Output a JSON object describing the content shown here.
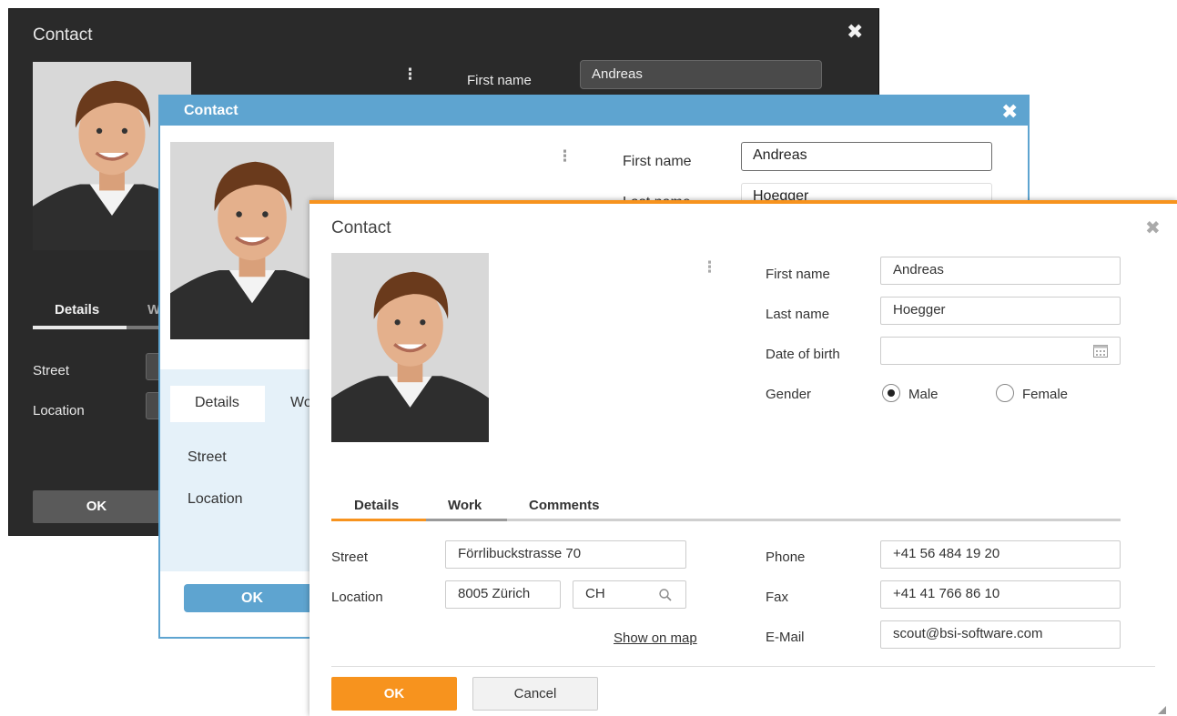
{
  "dark_dialog": {
    "title": "Contact",
    "close_glyph": "✖",
    "kebab_glyph": "⋮",
    "first_name_label": "First name",
    "first_name_value": "Andreas",
    "tabs": [
      "Details",
      "W"
    ],
    "street_label": "Street",
    "location_label": "Location",
    "ok_label": "OK",
    "colors": {
      "background": "#2a2a2a"
    }
  },
  "blue_dialog": {
    "title": "Contact",
    "close_glyph": "✖",
    "kebab_glyph": "⋮",
    "first_name_label": "First name",
    "first_name_value": "Andreas",
    "last_name_label": "Last name",
    "last_name_value": "Hoegger",
    "tabs": [
      "Details",
      "Wo"
    ],
    "street_label": "Street",
    "location_label": "Location",
    "ok_label": "OK",
    "colors": {
      "accent": "#5ea4d0"
    }
  },
  "white_dialog": {
    "title": "Contact",
    "close_glyph": "✖",
    "kebab_glyph": "⋮",
    "form": {
      "first_name_label": "First name",
      "first_name_value": "Andreas",
      "last_name_label": "Last name",
      "last_name_value": "Hoegger",
      "date_of_birth_label": "Date of birth",
      "date_of_birth_value": "",
      "gender_label": "Gender",
      "gender_options": [
        "Male",
        "Female"
      ],
      "gender_selected": "Male"
    },
    "tabs": [
      {
        "label": "Details",
        "active": true
      },
      {
        "label": "Work",
        "active": false
      },
      {
        "label": "Comments",
        "active": false
      }
    ],
    "details": {
      "street_label": "Street",
      "street_value": "Förrlibuckstrasse 70",
      "location_label": "Location",
      "zip_city_value": "8005 Zürich",
      "country_value": "CH",
      "show_on_map_label": "Show on map",
      "phone_label": "Phone",
      "phone_value": "+41 56 484 19 20",
      "fax_label": "Fax",
      "fax_value": "+41 41 766 86 10",
      "email_label": "E-Mail",
      "email_value": "scout@bsi-software.com"
    },
    "buttons": {
      "ok_label": "OK",
      "cancel_label": "Cancel"
    },
    "colors": {
      "accent": "#f7931e"
    },
    "icons": [
      "calendar-icon",
      "search-icon",
      "resize-grip-icon"
    ]
  }
}
